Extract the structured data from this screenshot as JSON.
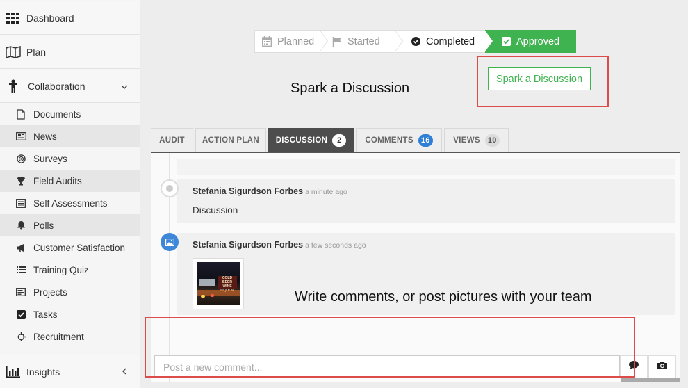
{
  "sidebar": {
    "top_items": [
      {
        "label": "Dashboard",
        "icon": "grid-icon"
      },
      {
        "label": "Plan",
        "icon": "map-icon"
      },
      {
        "label": "Collaboration",
        "icon": "person-icon",
        "expanded": true
      }
    ],
    "sub_items": [
      {
        "label": "Documents",
        "icon": "file-icon"
      },
      {
        "label": "News",
        "icon": "newspaper-icon"
      },
      {
        "label": "Surveys",
        "icon": "target-icon"
      },
      {
        "label": "Field Audits",
        "icon": "trophy-icon"
      },
      {
        "label": "Self Assessments",
        "icon": "list-check-icon"
      },
      {
        "label": "Polls",
        "icon": "bell-icon"
      },
      {
        "label": "Customer Satisfaction",
        "icon": "megaphone-icon"
      },
      {
        "label": "Training Quiz",
        "icon": "list-icon"
      },
      {
        "label": "Projects",
        "icon": "projects-icon"
      },
      {
        "label": "Tasks",
        "icon": "checkbox-icon"
      },
      {
        "label": "Recruitment",
        "icon": "crosshair-icon"
      }
    ],
    "bottom_item": {
      "label": "Insights",
      "icon": "bar-chart-icon"
    }
  },
  "workflow": {
    "steps": [
      {
        "label": "Planned",
        "icon": "calendar-icon",
        "state": "inactive"
      },
      {
        "label": "Started",
        "icon": "flag-icon",
        "state": "inactive"
      },
      {
        "label": "Completed",
        "icon": "check-circle-icon",
        "state": "done"
      },
      {
        "label": "Approved",
        "icon": "check-square-icon",
        "state": "current"
      }
    ],
    "accent_color": "#3fb34f"
  },
  "spark_button_label": "Spark a Discussion",
  "captions": {
    "spark": "Spark a Discussion",
    "comments": "Write comments, or post pictures with your team"
  },
  "tabs": [
    {
      "label": "AUDIT",
      "badge": ""
    },
    {
      "label": "ACTION PLAN",
      "badge": ""
    },
    {
      "label": "DISCUSSION",
      "badge": "2",
      "active": true
    },
    {
      "label": "COMMENTS",
      "badge": "16"
    },
    {
      "label": "VIEWS",
      "badge": "10"
    }
  ],
  "discussion": {
    "entries": [
      {
        "author": "Stefania Sigurdson Forbes",
        "time": "a minute ago",
        "text": "Discussion"
      },
      {
        "author": "Stefania Sigurdson Forbes",
        "time": "a few seconds ago",
        "image_text": "COLD BEER WINE LIQUOR"
      }
    ]
  },
  "comment": {
    "placeholder": "Post a new comment...",
    "send_icon": "speech-bubble-icon",
    "camera_icon": "camera-icon"
  },
  "colors": {
    "highlight_box": "#dd4b4b",
    "active_tab": "#4d4d4d",
    "comments_badge": "#2f7fd6"
  }
}
